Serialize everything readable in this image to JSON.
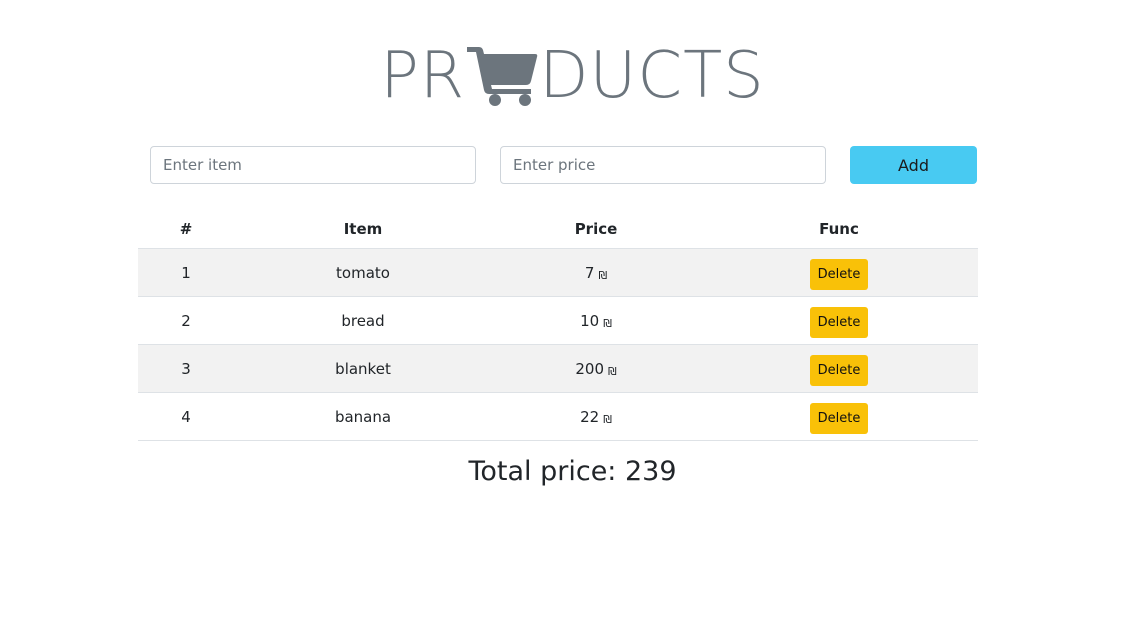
{
  "header": {
    "title_left": "PR",
    "title_right": "DUCTS",
    "cart_icon": "shopping-cart-icon"
  },
  "form": {
    "item_placeholder": "Enter item",
    "price_placeholder": "Enter price",
    "add_label": "Add"
  },
  "table": {
    "columns": [
      "#",
      "Item",
      "Price",
      "Func"
    ],
    "currency_symbol": "₪",
    "delete_label": "Delete",
    "rows": [
      {
        "num": "1",
        "item": "tomato",
        "price": "7"
      },
      {
        "num": "2",
        "item": "bread",
        "price": "10"
      },
      {
        "num": "3",
        "item": "blanket",
        "price": "200"
      },
      {
        "num": "4",
        "item": "banana",
        "price": "22"
      }
    ]
  },
  "total": {
    "label": "Total price: 239"
  },
  "colors": {
    "title": "#6c757d",
    "add_button": "#48caf2",
    "delete_button": "#f9c108",
    "striped_row": "#f2f2f2"
  }
}
